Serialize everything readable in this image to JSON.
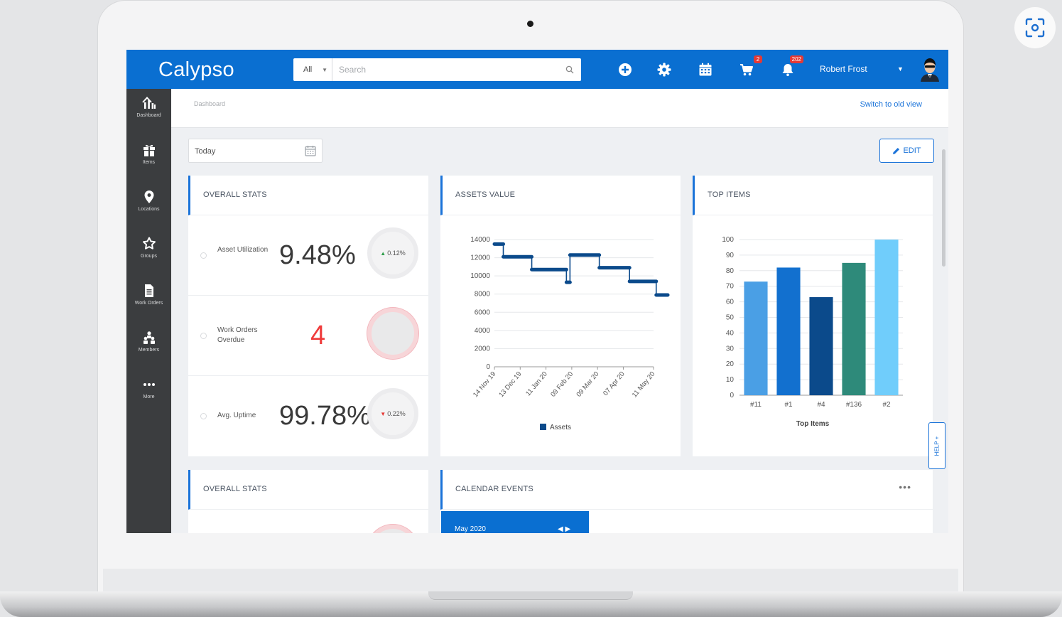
{
  "app": {
    "name": "Calypso"
  },
  "search": {
    "scope": "All",
    "placeholder": "Search"
  },
  "header_icons": [
    {
      "icon": "plus-circle-icon"
    },
    {
      "icon": "gear-icon"
    },
    {
      "icon": "calendar-icon"
    },
    {
      "icon": "cart-icon",
      "badge": "2"
    },
    {
      "icon": "bell-icon",
      "badge": "202"
    }
  ],
  "user": {
    "name": "Robert Frost"
  },
  "sidebar": {
    "items": [
      {
        "label": "Dashboard",
        "icon": "dashboard-icon"
      },
      {
        "label": "Items",
        "icon": "gift-icon"
      },
      {
        "label": "Locations",
        "icon": "map-pin-icon"
      },
      {
        "label": "Groups",
        "icon": "groups-icon"
      },
      {
        "label": "Work Orders",
        "icon": "document-icon"
      },
      {
        "label": "Members",
        "icon": "members-icon"
      },
      {
        "label": "More",
        "icon": "more-icon"
      }
    ]
  },
  "breadcrumb": "Dashboard",
  "switch_view": "Switch to old view",
  "date_filter": "Today",
  "edit_label": "EDIT",
  "help_label": "HELP +",
  "cards": {
    "overall_stats": {
      "title": "OVERALL STATS",
      "stats": [
        {
          "label": "Asset Utilization",
          "value": "9.48%",
          "change": "0.12%",
          "direction": "up"
        },
        {
          "label": "Work Orders Overdue",
          "value": "4"
        },
        {
          "label": "Avg. Uptime",
          "value": "99.78%",
          "change": "0.22%",
          "direction": "down"
        }
      ]
    },
    "assets_value": {
      "title": "ASSETS VALUE"
    },
    "top_items": {
      "title": "TOP ITEMS"
    },
    "overall_stats_2": {
      "title": "OVERALL STATS"
    },
    "calendar_events": {
      "title": "CALENDAR EVENTS",
      "month": "May 2020"
    }
  },
  "colors": {
    "primary": "#0a6fd1",
    "sidebar": "#3b3d3f",
    "alert": "#ef3b3b",
    "up": "#2e9d4a",
    "down": "#e53935"
  },
  "chart_data": [
    {
      "type": "line",
      "title": "",
      "step": true,
      "x": [
        "14 Nov 19",
        "13 Dec 19",
        "11 Jan 20",
        "09 Feb 20",
        "09 Mar 20",
        "07 Apr 20",
        "11 May 20"
      ],
      "ylim": [
        0,
        14000
      ],
      "yticks": [
        0,
        2000,
        4000,
        6000,
        8000,
        10000,
        12000,
        14000
      ],
      "series": [
        {
          "name": "Assets",
          "color": "#0b4a8b",
          "points": [
            [
              "14 Nov 19",
              13500
            ],
            [
              "24 Nov 19",
              13500
            ],
            [
              "24 Nov 19",
              12100
            ],
            [
              "26 Dec 19",
              12100
            ],
            [
              "26 Dec 19",
              10700
            ],
            [
              "03 Feb 20",
              10700
            ],
            [
              "03 Feb 20",
              9300
            ],
            [
              "07 Feb 20",
              9300
            ],
            [
              "07 Feb 20",
              12300
            ],
            [
              "11 Mar 20",
              12300
            ],
            [
              "11 Mar 20",
              10900
            ],
            [
              "14 Apr 20",
              10900
            ],
            [
              "14 Apr 20",
              9400
            ],
            [
              "14 May 20",
              9400
            ],
            [
              "14 May 20",
              7900
            ],
            [
              "27 May 20",
              7900
            ]
          ]
        }
      ],
      "grid": true,
      "legend": "bottom"
    },
    {
      "type": "bar",
      "title": "",
      "categories": [
        "#11",
        "#1",
        "#4",
        "#136",
        "#2"
      ],
      "values": [
        73,
        82,
        63,
        85,
        100
      ],
      "colors": [
        "#4a9fe5",
        "#1270cf",
        "#0b4a8b",
        "#2e8a7a",
        "#70cdfb"
      ],
      "xlabel": "Top Items",
      "ylim": [
        0,
        100
      ],
      "yticks": [
        0,
        10,
        20,
        30,
        40,
        50,
        60,
        70,
        80,
        90,
        100
      ],
      "grid": true
    }
  ]
}
